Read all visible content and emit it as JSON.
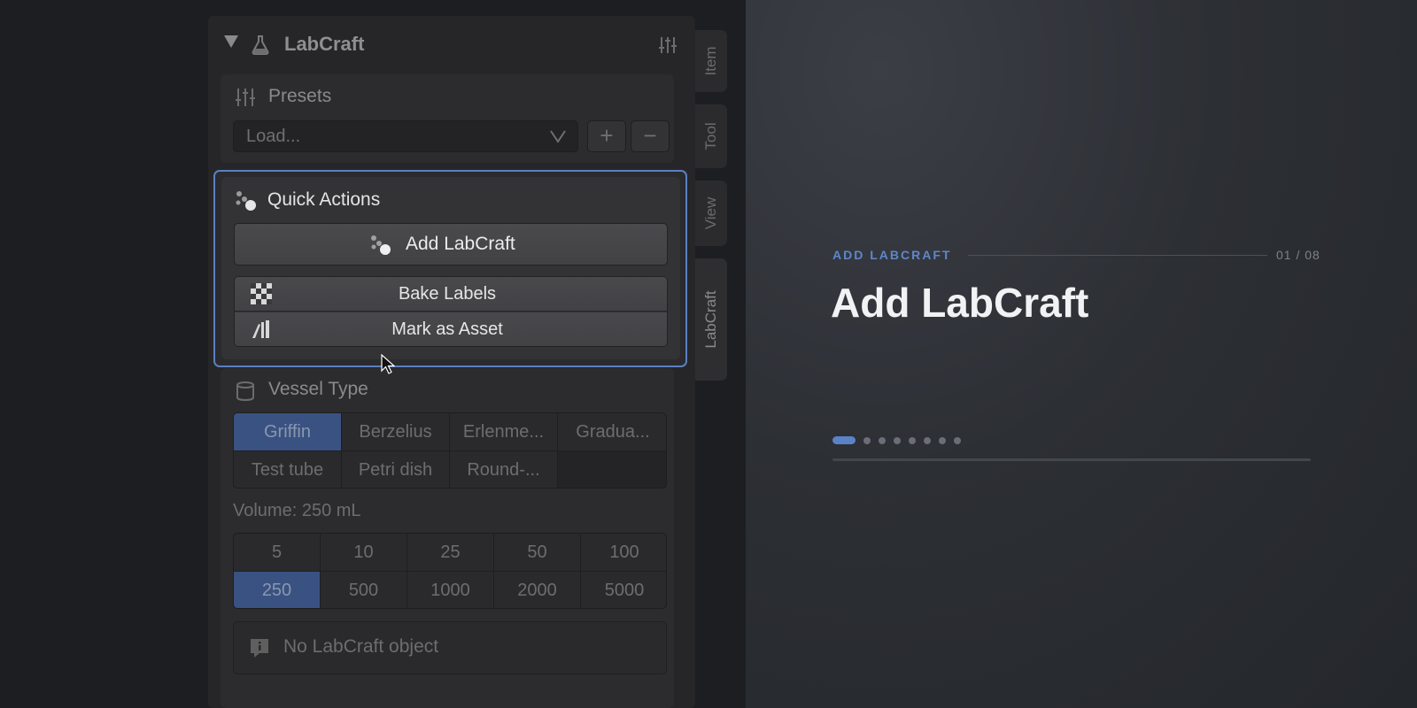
{
  "panel": {
    "title": "LabCraft",
    "icons": {
      "collapse": "triangle-down-icon",
      "logo": "flask-icon",
      "settings": "sliders-icon"
    }
  },
  "presets": {
    "title": "Presets",
    "select_value": "Load...",
    "add_label": "+",
    "remove_label": "−"
  },
  "quick_actions": {
    "title": "Quick Actions",
    "add_label": "Add LabCraft",
    "bake_label": "Bake Labels",
    "asset_label": "Mark as Asset"
  },
  "vessel": {
    "title": "Vessel Type",
    "options": [
      "Griffin",
      "Berzelius",
      "Erlenme...",
      "Gradua...",
      "Test tube",
      "Petri dish",
      "Round-..."
    ],
    "selected": "Griffin"
  },
  "volume": {
    "label": "Volume: 250 mL",
    "options": [
      "5",
      "10",
      "25",
      "50",
      "100",
      "250",
      "500",
      "1000",
      "2000",
      "5000"
    ],
    "selected": "250"
  },
  "info": {
    "message": "No LabCraft object"
  },
  "tabs": [
    "Item",
    "Tool",
    "View",
    "LabCraft"
  ],
  "active_tab": "LabCraft",
  "slide": {
    "eyebrow": "ADD LABCRAFT",
    "counter": "01 / 08",
    "headline": "Add LabCraft",
    "total": 8,
    "current": 1
  },
  "colors": {
    "accent": "#5b82c6",
    "selected_cell": "#3a5282",
    "highlight_border": "#5b7fc2"
  }
}
